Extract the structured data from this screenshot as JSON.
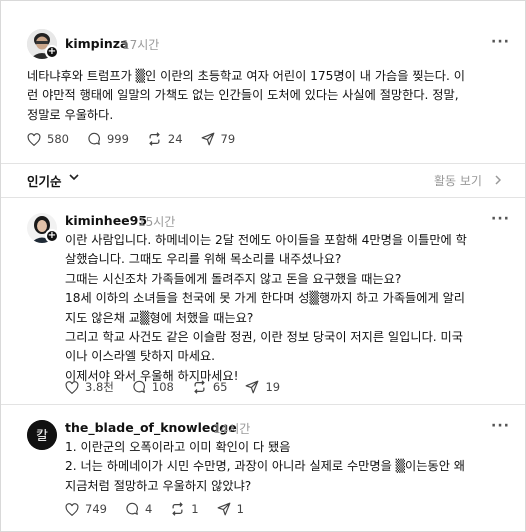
{
  "posts": [
    {
      "username": "kimpinza",
      "time": "17시간",
      "lines": [
        "네타냐후와 트럼프가 ▒인 이란의 초등학교 여자 어린이 175명이 내 가슴을 찢는다. 이",
        "런 야만적 행태에 일말의 가책도 없는 인간들이 도처에 있다는 사실에 절망한다. 정말,",
        "정말로 우울하다."
      ],
      "likes": "580",
      "replies": "999",
      "reposts": "24",
      "shares": "79"
    },
    {
      "username": "kiminhee95",
      "time": "15시간",
      "lines": [
        "이란 사람입니다. 하메네이는 2달 전에도 아이들을 포함해 4만명을 이틀만에 학",
        "살했습니다. 그때도 우리를 위해 목소리를 내주셨나요?",
        "그때는 시신조차 가족들에게 돌려주지 않고 돈을 요구했을 때는요?",
        "18세 이하의 소녀들을 천국에 못 가게 한다며 성▒행까지 하고 가족들에게 알리",
        "지도 않은채 교▒형에 처했을 때는요?",
        "그리고 학교 사건도 같은 이슬람 정권, 이란 정보 당국이 저지른 일입니다. 미국",
        "이나 이스라엘 탓하지 마세요.",
        "이제서야 와서 우울해 하지마세요!"
      ],
      "likes": "3.8천",
      "replies": "108",
      "reposts": "65",
      "shares": "19"
    },
    {
      "username": "the_blade_of_knowledge",
      "time": "14시간",
      "avatar_glyph": "칼",
      "lines": [
        "1. 이란군의 오폭이라고 이미 확인이 다 됐음",
        "2. 너는 하메네이가 시민 수만명, 과장이 아니라 실제로 수만명을 ▒이는동안 왜",
        "지금처럼 절망하고 우울하지 않았냐?"
      ],
      "likes": "749",
      "replies": "4",
      "reposts": "1",
      "shares": "1"
    }
  ],
  "sort": {
    "label": "인기순",
    "activity": "활동 보기"
  },
  "icons": {
    "more": "more-icon",
    "like": "heart-icon",
    "reply": "comment-icon",
    "repost": "repost-icon",
    "share": "send-icon",
    "follow": "plus-icon"
  },
  "colors": {
    "text": "#101010",
    "muted": "#999999",
    "divider": "#e3e3e3"
  }
}
